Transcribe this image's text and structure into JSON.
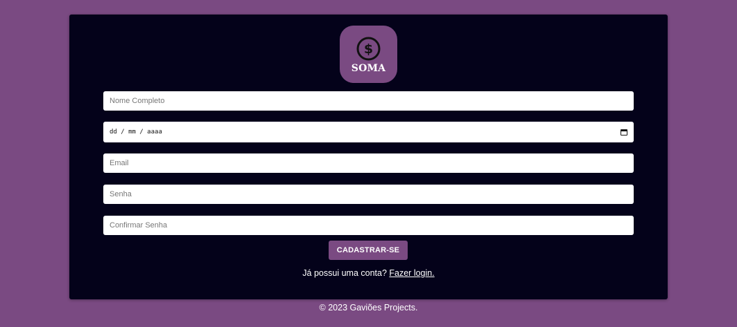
{
  "brand": {
    "name": "SOMA",
    "icon": "dollar-coin-icon"
  },
  "form": {
    "name_placeholder": "Nome Completo",
    "date_placeholder": "dd / mm / aaaa",
    "email_placeholder": "Email",
    "password_placeholder": "Senha",
    "confirm_placeholder": "Confirmar Senha",
    "submit_label": "CADASTRAR-SE"
  },
  "login": {
    "prompt": "Já possui uma conta?",
    "link_label": "Fazer login."
  },
  "footer": {
    "text": "© 2023 Gaviões Projects."
  },
  "colors": {
    "background": "#7a4a82",
    "card": "#04021a",
    "accent": "#7a4a82"
  }
}
